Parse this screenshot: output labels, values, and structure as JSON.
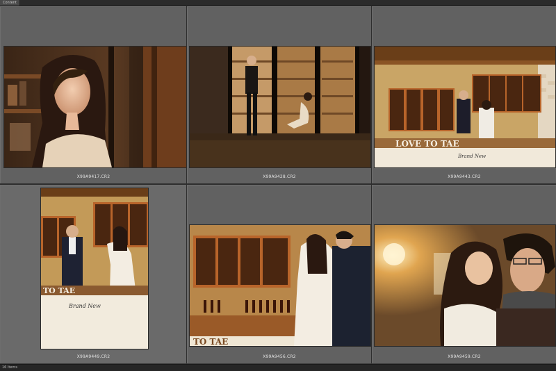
{
  "panel": {
    "title": "Content"
  },
  "bottom": {
    "label": "16 Items"
  },
  "thumbnails": [
    {
      "filename": "X99A9417.CR2"
    },
    {
      "filename": "X99A9428.CR2"
    },
    {
      "filename": "X99A9443.CR2"
    },
    {
      "filename": "X99A9449.CR2"
    },
    {
      "filename": "X99A9456.CR2"
    },
    {
      "filename": "X99A9459.CR2"
    }
  ],
  "signs": {
    "love_to_tae": "LOVE TO TAE",
    "to_tae": "TO TAE",
    "brand_new": "Brand New"
  },
  "colors": {
    "cell_bg": "#616161",
    "panel_bg": "#3a3a3a",
    "warm_wood": "#b8642a",
    "cream_wall": "#c9a566"
  }
}
